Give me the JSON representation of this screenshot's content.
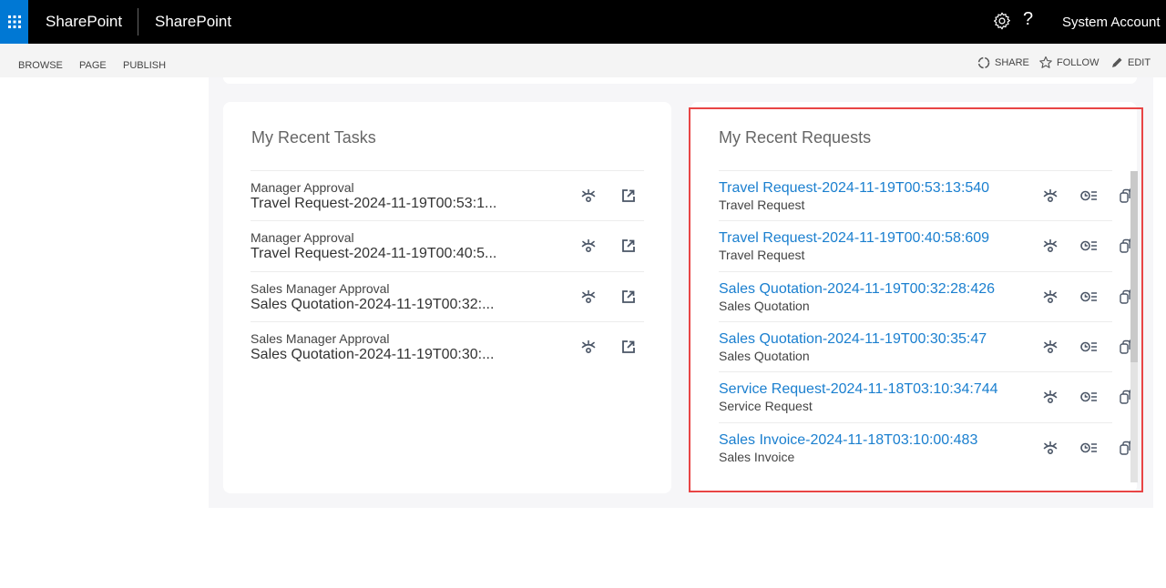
{
  "suitebar": {
    "app_launcher_icon": "waffle-icon",
    "brand": "SharePoint",
    "site_title": "SharePoint",
    "settings_icon": "gear-icon",
    "help_label": "?",
    "account": "System Account"
  },
  "ribbon": {
    "tabs": [
      "BROWSE",
      "PAGE",
      "PUBLISH"
    ],
    "actions": [
      {
        "icon": "share-icon",
        "label": "SHARE"
      },
      {
        "icon": "star-icon",
        "label": "FOLLOW"
      },
      {
        "icon": "pencil-icon",
        "label": "EDIT"
      }
    ]
  },
  "tasks": {
    "title": "My Recent Tasks",
    "items": [
      {
        "step": "Manager Approval",
        "name": "Travel Request-2024-11-19T00:53:1..."
      },
      {
        "step": "Manager Approval",
        "name": "Travel Request-2024-11-19T00:40:5..."
      },
      {
        "step": "Sales Manager Approval",
        "name": "Sales Quotation-2024-11-19T00:32:..."
      },
      {
        "step": "Sales Manager Approval",
        "name": "Sales Quotation-2024-11-19T00:30:..."
      }
    ],
    "row_icons": [
      "view-flow-icon",
      "open-external-icon"
    ]
  },
  "requests": {
    "title": "My Recent Requests",
    "items": [
      {
        "name": "Travel Request-2024-11-19T00:53:13:540",
        "type": "Travel Request"
      },
      {
        "name": "Travel Request-2024-11-19T00:40:58:609",
        "type": "Travel Request"
      },
      {
        "name": "Sales Quotation-2024-11-19T00:32:28:426",
        "type": "Sales Quotation"
      },
      {
        "name": "Sales Quotation-2024-11-19T00:30:35:47",
        "type": "Sales Quotation"
      },
      {
        "name": "Service Request-2024-11-18T03:10:34:744",
        "type": "Service Request"
      },
      {
        "name": "Sales Invoice-2024-11-18T03:10:00:483",
        "type": "Sales Invoice"
      }
    ],
    "row_icons": [
      "view-flow-icon",
      "history-icon",
      "copy-icon"
    ]
  },
  "colors": {
    "accent": "#0078d4",
    "link": "#1a7fcf",
    "highlight": "#e84545"
  }
}
